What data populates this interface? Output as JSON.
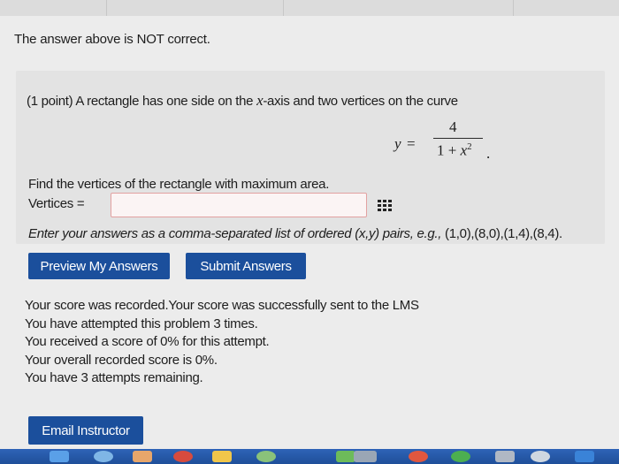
{
  "status_message": "The answer above is NOT correct.",
  "problem": {
    "points": "(1 point)",
    "question_start": "A rectangle has one side on the",
    "axis_var": "x",
    "question_end": "-axis and two vertices on the curve",
    "formula": {
      "lhs": "y",
      "eq": "=",
      "numerator": "4",
      "denominator_prefix": "1 + ",
      "denominator_var": "x",
      "denominator_exp": "2",
      "trailing": "."
    },
    "find_text": "Find the vertices of the rectangle with maximum area.",
    "answer_label": "Vertices =",
    "answer_value": "",
    "hint_prefix": "Enter your answers as a comma-separated list of ordered (x,y) pairs, e.g.,",
    "hint_example": "(1,0),(8,0),(1,4),(8,4)."
  },
  "buttons": {
    "preview": "Preview My Answers",
    "submit": "Submit Answers",
    "email": "Email Instructor"
  },
  "results": [
    "Your score was recorded.Your score was successfully sent to the LMS",
    "You have attempted this problem 3 times.",
    "You received a score of 0% for this attempt.",
    "Your overall recorded score is 0%.",
    "You have 3 attempts remaining."
  ],
  "colors": {
    "button_blue": "#1b4f9c",
    "input_border_error": "#e2a1a1",
    "taskbar": "#2e63b7"
  },
  "icons": [
    "equation-editor-grid-icon"
  ]
}
